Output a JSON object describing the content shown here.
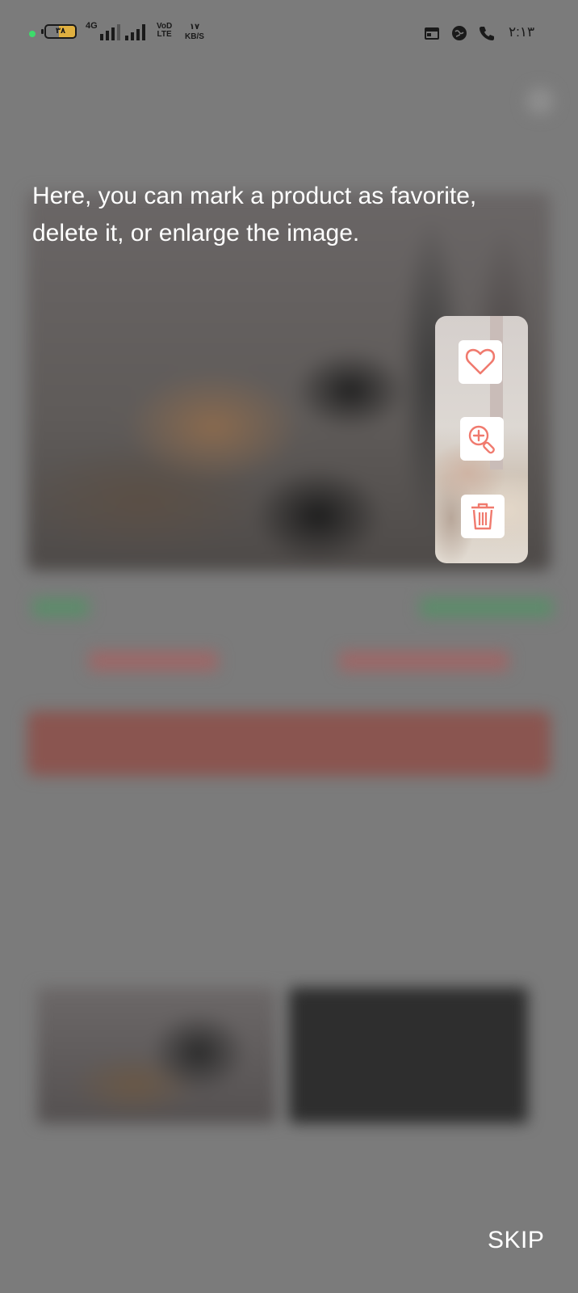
{
  "status_bar": {
    "battery": "۳۸",
    "network": "4G",
    "volte_top": "VoD",
    "volte_bottom": "LTE",
    "speed_value": "۱۷",
    "speed_unit": "KB/S",
    "time": "۲:۱۳",
    "icons": [
      "calendar-icon",
      "globe-icon",
      "phone-icon"
    ]
  },
  "coach": {
    "message": "Here, you can mark a product as favorite, delete it, or enlarge the image.",
    "actions": [
      {
        "name": "favorite",
        "icon": "heart-icon"
      },
      {
        "name": "enlarge",
        "icon": "zoom-in-icon"
      },
      {
        "name": "delete",
        "icon": "trash-icon"
      }
    ],
    "skip_label": "SKIP"
  },
  "colors": {
    "accent_icon": "#f07a6e",
    "overlay": "#7b7b7b",
    "text": "#ffffff"
  }
}
